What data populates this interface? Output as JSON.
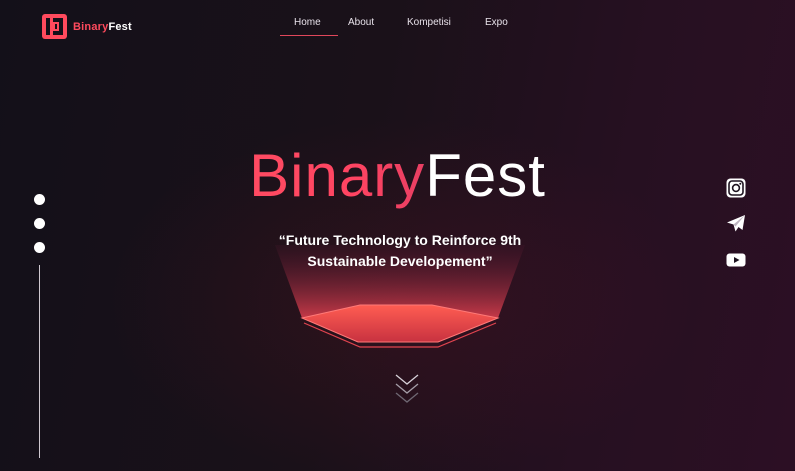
{
  "header": {
    "logo": {
      "word1": "Binary",
      "word2": "Fest"
    },
    "nav": [
      {
        "label": "Home",
        "active": true
      },
      {
        "label": "About"
      },
      {
        "label": "Kompetisi"
      },
      {
        "label": "Expo"
      }
    ]
  },
  "hero": {
    "title_part1": "Binary",
    "title_part2": "Fest",
    "tagline_line1": "“Future Technology to Reinforce 9th",
    "tagline_line2": "Sustainable Developement”"
  },
  "colors": {
    "accent": "#ff4a5d",
    "background": "#1a1119"
  },
  "icons": {
    "social": [
      "instagram-icon",
      "telegram-icon",
      "youtube-icon"
    ],
    "scroll": "chevrons-down-icon"
  }
}
